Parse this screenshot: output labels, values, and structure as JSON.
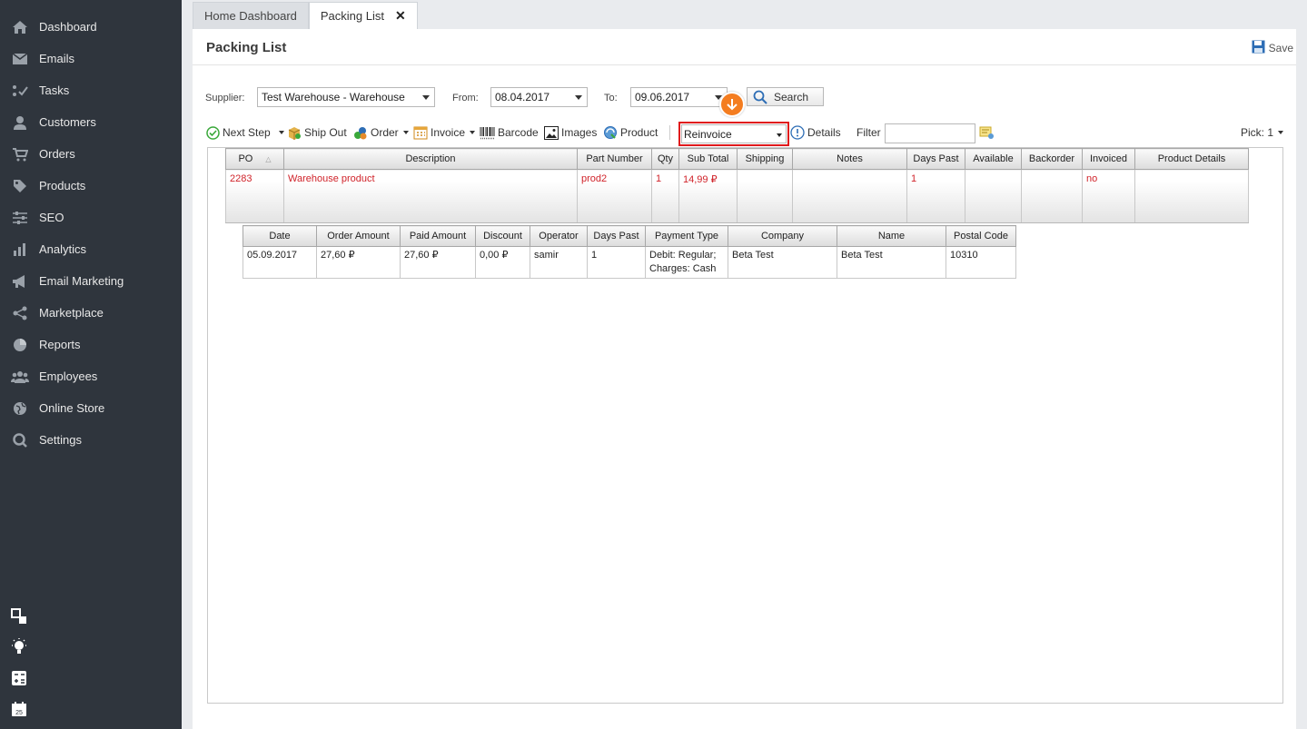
{
  "sidebar": {
    "items": [
      {
        "label": "Dashboard",
        "icon": "home-icon"
      },
      {
        "label": "Emails",
        "icon": "envelope-icon"
      },
      {
        "label": "Tasks",
        "icon": "tasks-icon"
      },
      {
        "label": "Customers",
        "icon": "person-icon"
      },
      {
        "label": "Orders",
        "icon": "cart-icon"
      },
      {
        "label": "Products",
        "icon": "tag-icon"
      },
      {
        "label": "SEO",
        "icon": "sliders-icon"
      },
      {
        "label": "Analytics",
        "icon": "bar-chart-icon"
      },
      {
        "label": "Email Marketing",
        "icon": "megaphone-icon"
      },
      {
        "label": "Marketplace",
        "icon": "share-icon"
      },
      {
        "label": "Reports",
        "icon": "pie-chart-icon"
      },
      {
        "label": "Employees",
        "icon": "group-icon"
      },
      {
        "label": "Online Store",
        "icon": "globe-icon"
      },
      {
        "label": "Settings",
        "icon": "settings-icon"
      }
    ]
  },
  "tabs": [
    {
      "label": "Home Dashboard"
    },
    {
      "label": "Packing List"
    }
  ],
  "page": {
    "title": "Packing List",
    "save_label": "Save"
  },
  "filters": {
    "supplier_label": "Supplier:",
    "supplier_value": "Test Warehouse - Warehouse",
    "from_label": "From:",
    "from_value": "08.04.2017",
    "to_label": "To:",
    "to_value": "09.06.2017",
    "search_label": "Search"
  },
  "toolbar": {
    "next_step": "Next Step",
    "ship_out": "Ship Out",
    "order": "Order",
    "invoice": "Invoice",
    "barcode": "Barcode",
    "images": "Images",
    "product": "Product",
    "reinvoice": "Reinvoice",
    "details": "Details",
    "filter_label": "Filter",
    "pick": "Pick: 1"
  },
  "main_grid": {
    "headers": [
      "PO",
      "Description",
      "Part Number",
      "Qty",
      "Sub Total",
      "Shipping",
      "Notes",
      "Days Past",
      "Available",
      "Backorder",
      "Invoiced",
      "Product Details"
    ],
    "row": [
      "2283",
      "Warehouse product",
      "prod2",
      "1",
      "14,99 ₽",
      "",
      "",
      "1",
      "",
      "",
      "no",
      ""
    ]
  },
  "detail_grid": {
    "headers": [
      "Date",
      "Order Amount",
      "Paid Amount",
      "Discount",
      "Operator",
      "Days Past",
      "Payment Type",
      "Company",
      "Name",
      "Postal Code"
    ],
    "row": [
      "05.09.2017",
      "27,60 ₽",
      "27,60 ₽",
      "0,00 ₽",
      "samir",
      "1",
      "Debit: Regular; Charges: Cash",
      "Beta Test",
      "Beta Test",
      "10310"
    ]
  }
}
